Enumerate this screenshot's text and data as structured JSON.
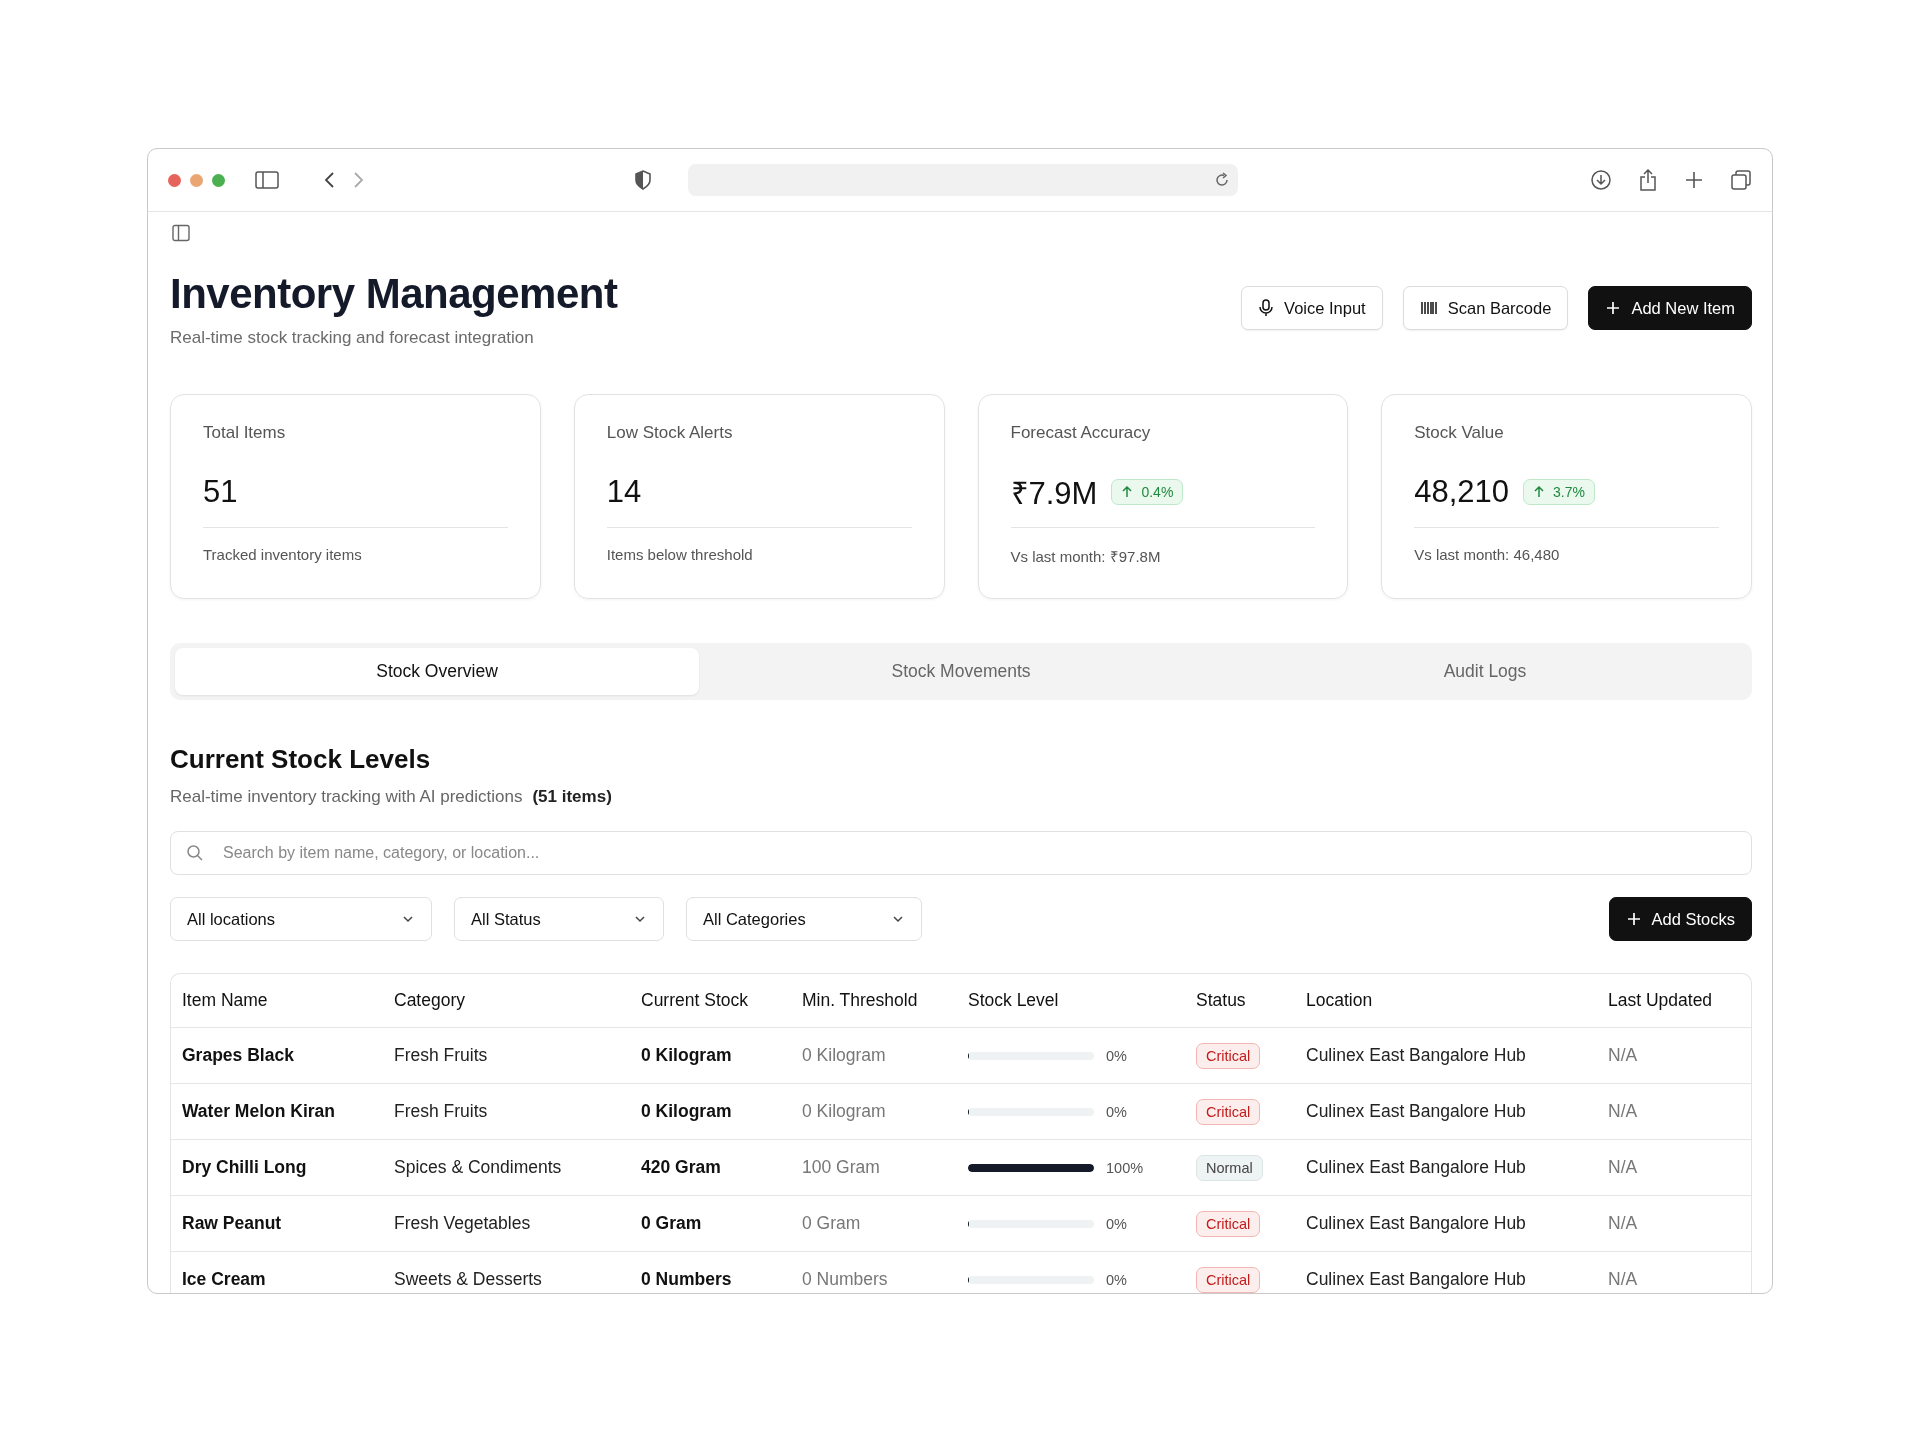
{
  "header": {
    "title": "Inventory Management",
    "subtitle": "Real-time stock tracking and forecast integration",
    "buttons": [
      {
        "label": "Voice Input",
        "kind": "mic"
      },
      {
        "label": "Scan Barcode",
        "kind": "barcode"
      },
      {
        "label": "Add New Item",
        "kind": "primary"
      }
    ]
  },
  "stats": [
    {
      "label": "Total Items",
      "value": "51",
      "note": "Tracked inventory items"
    },
    {
      "label": "Low Stock Alerts",
      "value": "14",
      "note": "Items below threshold"
    },
    {
      "label": "Forecast Accuracy",
      "value": "₹7.9M",
      "change": "0.4%",
      "note": "Vs last month: ₹97.8M"
    },
    {
      "label": "Stock Value",
      "value": "48,210",
      "change": "3.7%",
      "note": "Vs last month: 46,480"
    }
  ],
  "tabs": [
    {
      "label": "Stock Overview",
      "selected": true
    },
    {
      "label": "Stock Movements",
      "selected": false
    },
    {
      "label": "Audit Logs",
      "selected": false
    }
  ],
  "section": {
    "title": "Current Stock Levels",
    "subtitle": "Real-time inventory tracking with AI predictions",
    "count": "(51 items)"
  },
  "search": {
    "placeholder": "Search by item name, category, or location..."
  },
  "filters": [
    "All locations",
    "All Status",
    "All Categories"
  ],
  "add_button": "Add Stocks",
  "table": {
    "columns": [
      "Item Name",
      "Category",
      "Current Stock",
      "Min. Threshold",
      "Stock Level",
      "Status",
      "Location",
      "Last Updated"
    ],
    "rows": [
      {
        "name": "Grapes Black",
        "category": "Fresh Fruits",
        "stock": "0 Kilogram",
        "threshold": "0 Kilogram",
        "level": 0,
        "percent": "0%",
        "status": "Critical",
        "kind": "critical",
        "location": "Culinex East Bangalore Hub",
        "updated": "N/A"
      },
      {
        "name": "Water Melon Kiran",
        "category": "Fresh Fruits",
        "stock": "0 Kilogram",
        "threshold": "0 Kilogram",
        "level": 0,
        "percent": "0%",
        "status": "Critical",
        "kind": "critical",
        "location": "Culinex East Bangalore Hub",
        "updated": "N/A"
      },
      {
        "name": "Dry Chilli Long",
        "category": "Spices & Condiments",
        "stock": "420 Gram",
        "threshold": "100 Gram",
        "level": 1,
        "percent": "100%",
        "status": "Normal",
        "kind": "normal",
        "location": "Culinex East Bangalore Hub",
        "updated": "N/A"
      },
      {
        "name": "Raw Peanut",
        "category": "Fresh Vegetables",
        "stock": "0 Gram",
        "threshold": "0 Gram",
        "level": 0,
        "percent": "0%",
        "status": "Critical",
        "kind": "critical",
        "location": "Culinex East Bangalore Hub",
        "updated": "N/A"
      },
      {
        "name": "Ice Cream",
        "category": "Sweets & Desserts",
        "stock": "0 Numbers",
        "threshold": "0 Numbers",
        "level": 0,
        "percent": "0%",
        "status": "Critical",
        "kind": "critical",
        "location": "Culinex East Bangalore Hub",
        "updated": "N/A"
      }
    ]
  }
}
